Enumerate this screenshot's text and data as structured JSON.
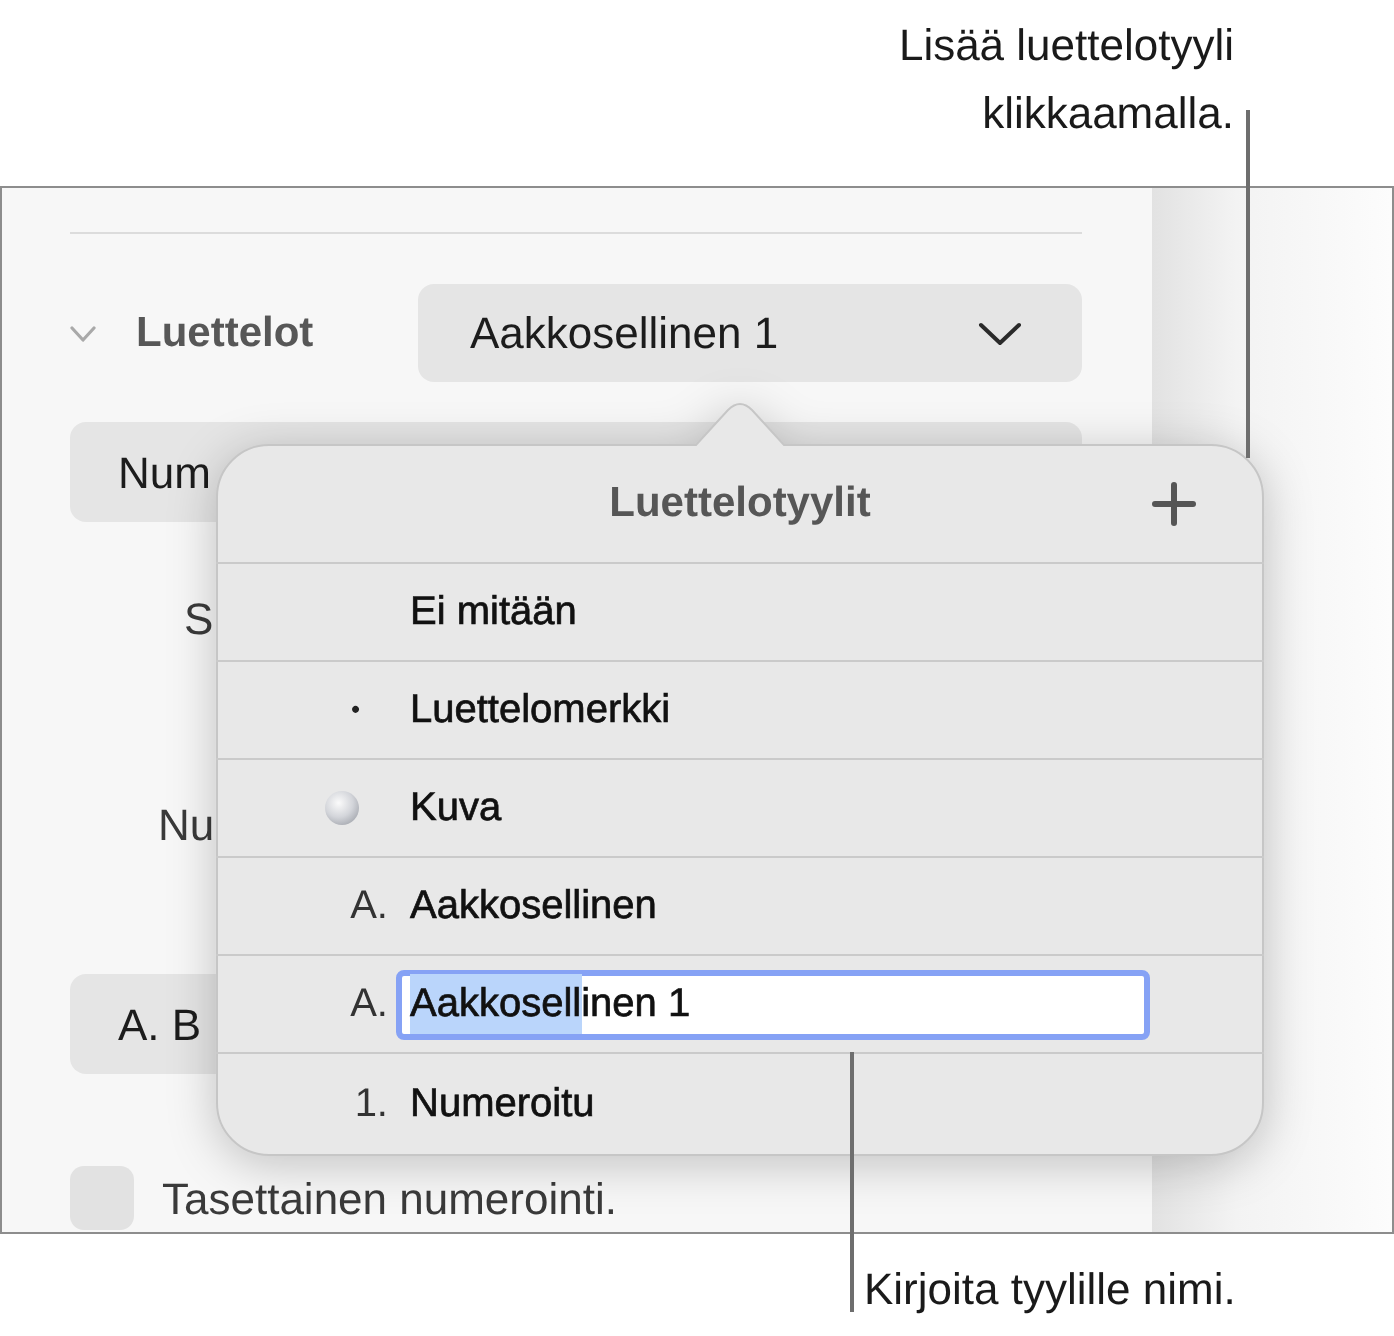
{
  "callouts": [
    {
      "text": "Lisää luettelotyyli klikkaamalla."
    },
    {
      "text": "Kirjoita tyylille nimi."
    }
  ],
  "inspector": {
    "section": {
      "title": "Luettelot",
      "expanded": true,
      "dropdown": "Aakkosellinen 1"
    },
    "controls": [
      {
        "kind": "popup",
        "text": "Num"
      },
      {
        "kind": "label",
        "text": "S"
      },
      {
        "kind": "label",
        "text": "Nu"
      },
      {
        "kind": "popup",
        "text": "A. B"
      },
      {
        "kind": "checkbox",
        "label": "Tasettainen numerointi.",
        "checked": false
      }
    ]
  },
  "popover": {
    "title": "Luettelotyylit",
    "styles": [
      {
        "kind": "plain",
        "label": "Ei mitään"
      },
      {
        "kind": "bullet",
        "marker": "•",
        "label": "Luettelomerkki"
      },
      {
        "kind": "image",
        "label": "Kuva"
      },
      {
        "kind": "text",
        "marker": "A.",
        "label": "Aakkosellinen"
      },
      {
        "kind": "edit",
        "marker": "A.",
        "value_parts": [
          {
            "text": "Aakkosell",
            "selected": true
          },
          {
            "text": "inen 1",
            "selected": false
          }
        ]
      },
      {
        "kind": "text",
        "marker": "1.",
        "label": "Numeroitu"
      }
    ]
  }
}
